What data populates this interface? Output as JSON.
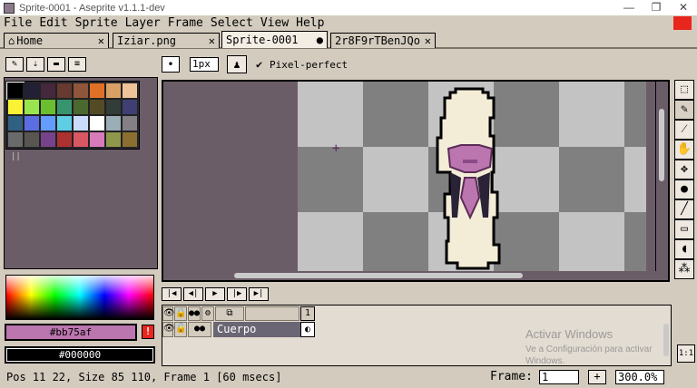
{
  "window": {
    "title": "Sprite-0001 - Aseprite v1.1.1-dev",
    "minimize": "—",
    "maximize": "❐",
    "close": "✕"
  },
  "menu": [
    "File",
    "Edit",
    "Sprite",
    "Layer",
    "Frame",
    "Select",
    "View",
    "Help"
  ],
  "tabs": [
    {
      "label": "Home",
      "icon": "home-icon",
      "close": "✕"
    },
    {
      "label": "Iziar.png",
      "close": "✕"
    },
    {
      "label": "Sprite-0001",
      "close": "●",
      "active": true
    },
    {
      "label": "2r8F9rTBenJQo",
      "close": "✕"
    }
  ],
  "palette_tools": [
    "✎",
    "⇣",
    "▬",
    "≡"
  ],
  "palette_colors": [
    "#000000",
    "#222034",
    "#45283c",
    "#663931",
    "#8f563b",
    "#df7126",
    "#d9a066",
    "#eec39a",
    "#fbf236",
    "#99e550",
    "#6abe30",
    "#37946e",
    "#4b692f",
    "#524b24",
    "#323c39",
    "#3f3f74",
    "#306082",
    "#5b6ee1",
    "#639bff",
    "#5fcde4",
    "#cbdbfc",
    "#ffffff",
    "#9badb7",
    "#847e87",
    "#696a6a",
    "#595652",
    "#76428a",
    "#ac3232",
    "#d95763",
    "#d77bba",
    "#8f974a",
    "#8a6f30"
  ],
  "colors": {
    "foreground_label": "#bb75af",
    "foreground": "#bb75af",
    "background_label": "#000000",
    "background": "#000000",
    "warning": "!"
  },
  "context_bar": {
    "brush_shape": "•",
    "brush_size": "1px",
    "ink_icon": "♟",
    "pixel_perfect_checked": "✔",
    "pixel_perfect_label": "Pixel-perfect"
  },
  "timeline": {
    "buttons": [
      "|◀",
      "◀|",
      "▶",
      "|▶",
      "▶|"
    ],
    "header_icons": [
      "👁",
      "🔒",
      "●●",
      "⚙",
      "⧉"
    ],
    "frame_number": "1",
    "layer": {
      "name": "Cuerpo",
      "visible": "👁",
      "lock": "🔓",
      "onion": "●●"
    },
    "cel": "◐"
  },
  "watermark": {
    "title": "Activar Windows",
    "line1": "Ve a Configuración para activar",
    "line2": "Windows."
  },
  "ratio_button": "1:1",
  "status": {
    "text": "Pos 11 22, Size 85 110, Frame 1 [60 msecs]",
    "frame_label": "Frame:",
    "frame_value": "1",
    "add_frame": "+",
    "zoom": "300.0%"
  },
  "right_tools": [
    "marquee-icon",
    "pencil-icon",
    "eyedropper-icon",
    "hand-icon",
    "move-icon",
    "fill-icon",
    "line-icon",
    "rectangle-icon",
    "contour-icon",
    "blur-icon"
  ]
}
